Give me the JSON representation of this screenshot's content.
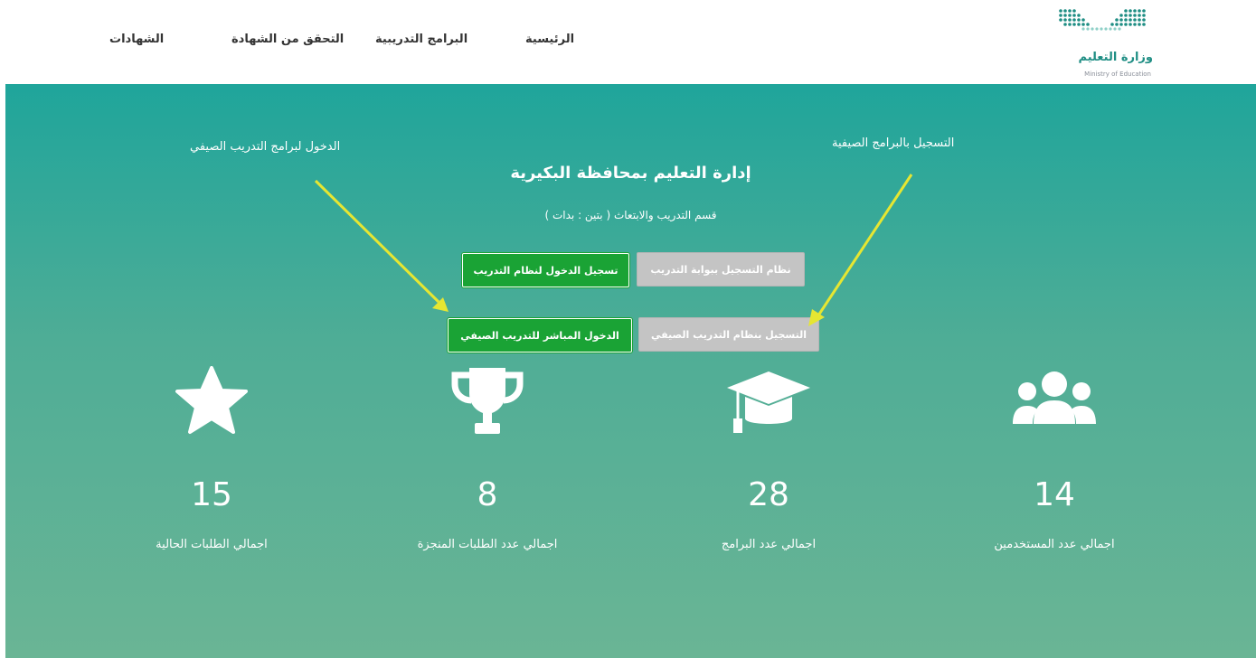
{
  "nav": {
    "items": [
      "الرئيسية",
      "البرامج التدريبية",
      "التحقق من الشهادة",
      "الشهادات"
    ]
  },
  "logo": {
    "arabic": "وزارة التعليم",
    "english": "Ministry of Education",
    "icon": "ministry-dots-logo"
  },
  "hero": {
    "title": "إدارة التعليم بمحافظة البكيرية",
    "subtitle": "قسم التدريب والابتعاث ( بتين : بدات )",
    "buttons": {
      "register_portal": "نظام التسجيل ببوابة التدريب",
      "login_training": "تسجيل الدخول لنظام التدريب",
      "register_summer": "التسجيل بنظام التدريب الصيفي",
      "direct_summer": "الدخول المباشر للتدريب الصيفي"
    },
    "annotations": {
      "left": "الدخول لبرامج التدريب الصيفي",
      "right": "التسجيل بالبرامج الصيفية"
    },
    "colors": {
      "gradient_top": "#1fa59b",
      "gradient_bottom": "#6ab595",
      "btn_green": "#1aa335",
      "btn_gray": "#c4c4c4",
      "arrow": "#e6e632"
    }
  },
  "stats": [
    {
      "icon": "star-icon",
      "number": "15",
      "label": "اجمالي الطلبات الحالية"
    },
    {
      "icon": "trophy-icon",
      "number": "8",
      "label": "اجمالي عدد الطلبات المنجزة"
    },
    {
      "icon": "graduation-cap-icon",
      "number": "28",
      "label": "اجمالي عدد البرامج"
    },
    {
      "icon": "users-icon",
      "number": "14",
      "label": "اجمالي عدد المستخدمين"
    }
  ]
}
